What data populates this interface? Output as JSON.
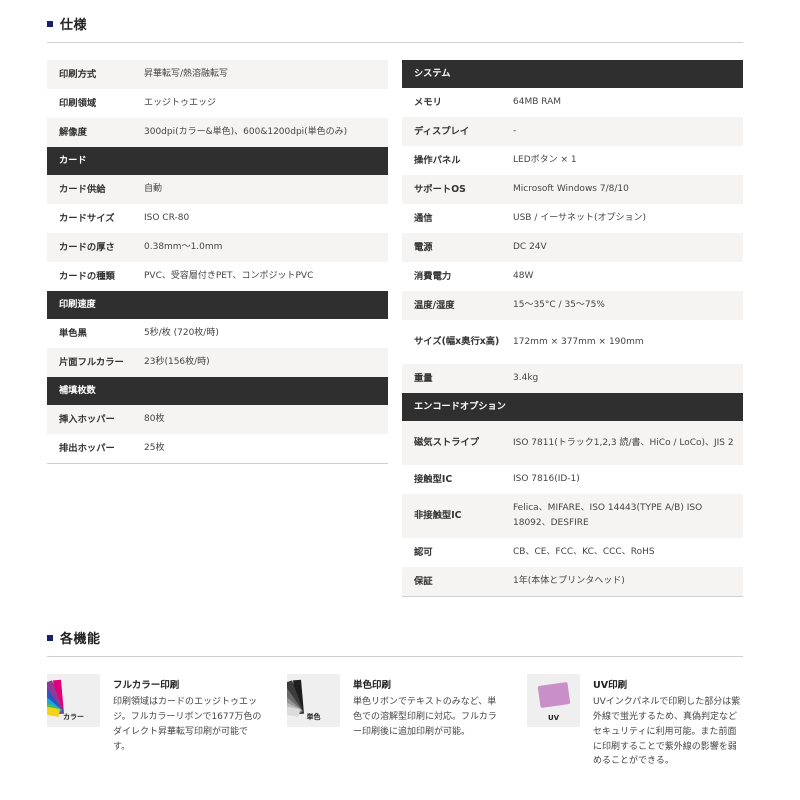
{
  "spec_heading": "仕様",
  "spec_left": [
    {
      "label": "印刷方式",
      "value": "昇華転写/熱溶融転写"
    },
    {
      "label": "印刷領域",
      "value": "エッジトゥエッジ"
    },
    {
      "label": "解像度",
      "value": "300dpi(カラー&単色)、600&1200dpi(単色のみ)"
    },
    {
      "category": "カード"
    },
    {
      "label": "カード供給",
      "value": "自動"
    },
    {
      "label": "カードサイズ",
      "value": "ISO CR-80"
    },
    {
      "label": "カードの厚さ",
      "value": "0.38mm〜1.0mm"
    },
    {
      "label": "カードの種類",
      "value": "PVC、受容層付きPET、コンポジットPVC"
    },
    {
      "category": "印刷速度"
    },
    {
      "label": "単色黒",
      "value": "5秒/枚 (720枚/時)"
    },
    {
      "label": "片面フルカラー",
      "value": "23秒(156枚/時)"
    },
    {
      "category": "補填枚数"
    },
    {
      "label": "挿入ホッパー",
      "value": "80枚"
    },
    {
      "label": "排出ホッパー",
      "value": "25枚"
    }
  ],
  "spec_right": [
    {
      "category": "システム"
    },
    {
      "label": "メモリ",
      "value": "64MB RAM"
    },
    {
      "label": "ディスプレイ",
      "value": "-"
    },
    {
      "label": "操作パネル",
      "value": "LEDボタン × 1"
    },
    {
      "label": "サポートOS",
      "value": "Microsoft Windows 7/8/10"
    },
    {
      "label": "通信",
      "value": "USB / イーサネット(オプション)"
    },
    {
      "label": "電源",
      "value": "DC 24V"
    },
    {
      "label": "消費電力",
      "value": "48W"
    },
    {
      "label": "温度/湿度",
      "value": "15〜35°C / 35〜75%"
    },
    {
      "label": "サイズ(幅x奥行x高)",
      "value": "172mm × 377mm × 190mm",
      "height": 44
    },
    {
      "label": "重量",
      "value": "3.4kg"
    },
    {
      "category": "エンコードオプション"
    },
    {
      "label": "磁気ストライプ",
      "value": "ISO 7811(トラック1,2,3 読/書、HiCo / LoCo)、JIS 2",
      "height": 44
    },
    {
      "label": "接触型IC",
      "value": "ISO 7816(ID-1)"
    },
    {
      "label": "非接触型IC",
      "value": "Felica、MIFARE、ISO 14443(TYPE A/B) ISO 18092、DESFIRE",
      "height": 44
    },
    {
      "label": "認可",
      "value": "CB、CE、FCC、KC、CCC、RoHS"
    },
    {
      "label": "保証",
      "value": "1年(本体とプリンタヘッド)"
    }
  ],
  "features_heading": "各機能",
  "features": [
    {
      "title": "フルカラー印刷",
      "caption": "カラー",
      "icon": "color-fan-icon",
      "desc": "印刷領域はカードのエッジトゥエッジ。フルカラーリボンで1677万色のダイレクト昇華転写印刷が可能です。"
    },
    {
      "title": "単色印刷",
      "caption": "単色",
      "icon": "mono-fan-icon",
      "desc": "単色リボンでテキストのみなど、単色での溶解型印刷に対応。フルカラー印刷後に追加印刷が可能。"
    },
    {
      "title": "UV印刷",
      "caption": "UV",
      "icon": "uv-card-icon",
      "desc": "UVインクパネルで印刷した部分は紫外線で蛍光するため、真偽判定などセキュリティに利用可能。また前面に印刷することで紫外線の影響を弱めることができる。"
    }
  ],
  "colors": {
    "header_bg": "#2f2f2f",
    "stripe_bg": "#f5f4f3",
    "bullet": "#1a1f6e",
    "uv_card": "#c98fc9"
  }
}
